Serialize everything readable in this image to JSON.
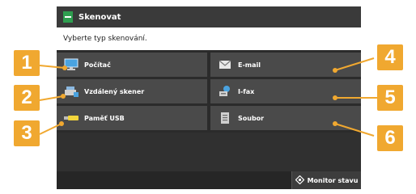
{
  "window": {
    "title": "Skenovat",
    "title_icon": "scanner-icon"
  },
  "prompt": "Vyberte typ skenování.",
  "options": [
    {
      "label": "Počítač",
      "icon": "computer-icon"
    },
    {
      "label": "E-mail",
      "icon": "envelope-icon"
    },
    {
      "label": "Vzdálený skener",
      "icon": "remote-scanner-icon"
    },
    {
      "label": "I-fax",
      "icon": "ifax-icon"
    },
    {
      "label": "Paměť USB",
      "icon": "usb-drive-icon"
    },
    {
      "label": "Soubor",
      "icon": "file-icon"
    }
  ],
  "status_button": {
    "label": "Monitor stavu",
    "icon": "status-monitor-icon"
  },
  "callouts": [
    "1",
    "2",
    "3",
    "4",
    "5",
    "6"
  ],
  "colors": {
    "callout": "#f0a830",
    "screen_bg": "#2b2b2b",
    "button_bg": "#4a4a4a"
  }
}
